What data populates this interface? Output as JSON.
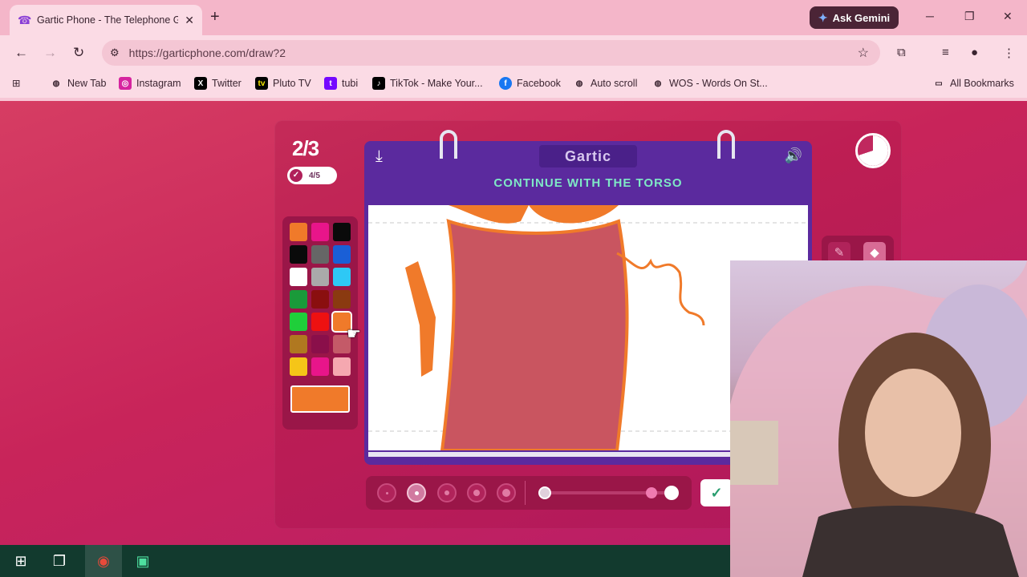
{
  "browser": {
    "tab_title": "Gartic Phone - The Telephone G",
    "url": "https://garticphone.com/draw?2",
    "gemini_label": "Ask Gemini"
  },
  "bookmarks": [
    {
      "label": "New Tab",
      "icon": "globe-icon",
      "color": "#3a2430"
    },
    {
      "label": "Instagram",
      "icon": "instagram-icon",
      "color": "#d6249f"
    },
    {
      "label": "Twitter",
      "icon": "x-icon",
      "color": "#000000"
    },
    {
      "label": "Pluto TV",
      "icon": "pluto-icon",
      "color": "#000000"
    },
    {
      "label": "tubi",
      "icon": "tubi-icon",
      "color": "#7408ff"
    },
    {
      "label": "TikTok - Make Your...",
      "icon": "tiktok-icon",
      "color": "#000000"
    },
    {
      "label": "Facebook",
      "icon": "facebook-icon",
      "color": "#1877f2"
    },
    {
      "label": "Auto scroll",
      "icon": "globe-icon",
      "color": "#3a2430"
    },
    {
      "label": "WOS - Words On St...",
      "icon": "globe-icon",
      "color": "#3a2430"
    }
  ],
  "all_bookmarks_label": "All Bookmarks",
  "game": {
    "round_counter": "2/3",
    "players_done": "4/5",
    "logo_text": "Gartic",
    "prompt": "CONTINUE WITH THE TORSO",
    "timer_remaining": 0.3,
    "selected_brush_size": 2,
    "opacity": 1.0
  },
  "palette": {
    "colors": [
      "#f07a2a",
      "#e8158a",
      "#0a0a0a",
      "#0a0a0a",
      "#666666",
      "#1a5fd6",
      "#ffffff",
      "#aaaaaa",
      "#2ec8f5",
      "#1a9a3a",
      "#8a0f0f",
      "#8a3a10",
      "#1fcf3a",
      "#ee1111",
      "#f07a2a",
      "#b07820",
      "#8a0f4a",
      "#c45a68",
      "#f5c518",
      "#e8158a",
      "#f5a8b0"
    ],
    "selected_index": 14,
    "current_color": "#f07a2a"
  },
  "colors": {
    "accent_prompt": "#7fe8c6",
    "board_purple": "#5b2a9e",
    "page_red": "#c8245a"
  }
}
